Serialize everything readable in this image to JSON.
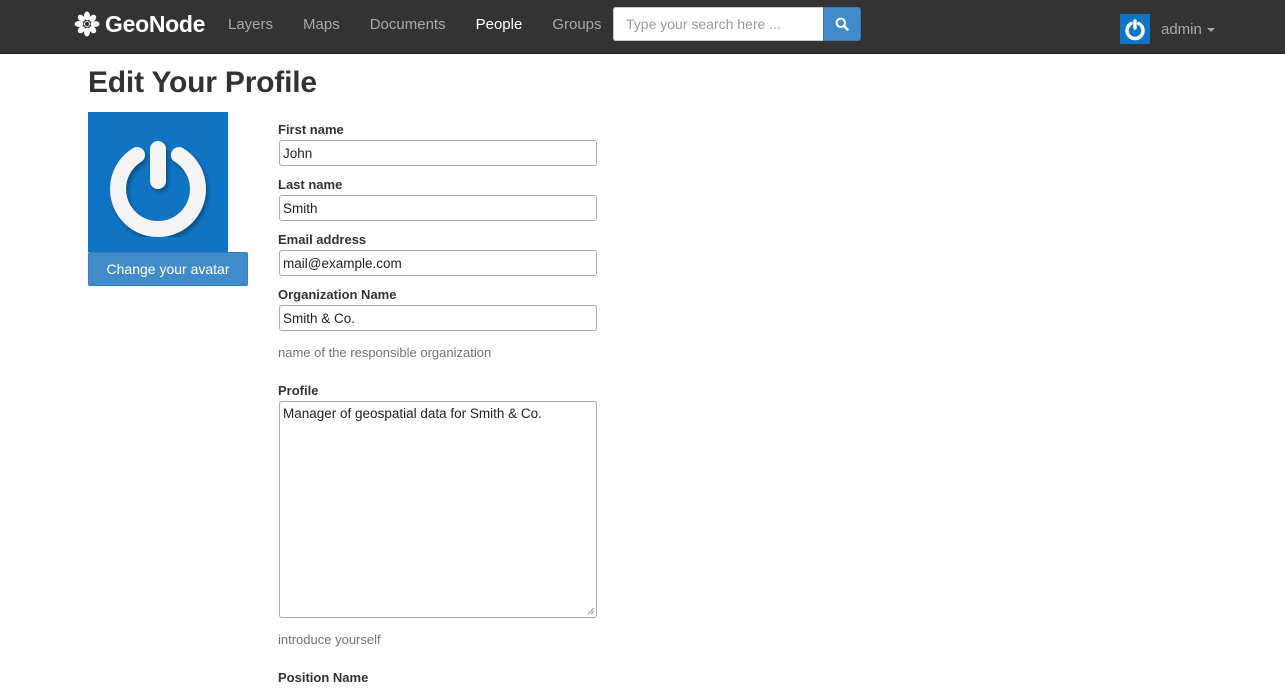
{
  "brand": {
    "name": "GeoNode"
  },
  "nav": {
    "items": [
      {
        "label": "Layers",
        "active": false
      },
      {
        "label": "Maps",
        "active": false
      },
      {
        "label": "Documents",
        "active": false
      },
      {
        "label": "People",
        "active": true
      },
      {
        "label": "Groups",
        "active": false
      }
    ]
  },
  "search": {
    "placeholder": "Type your search here ...",
    "icon": "search-icon"
  },
  "user": {
    "name": "admin",
    "avatar_icon": "gravatar-power-icon"
  },
  "page": {
    "title": "Edit Your Profile"
  },
  "avatar": {
    "change_label": "Change your avatar",
    "color": "#1074c4"
  },
  "form": {
    "first_name": {
      "label": "First name",
      "value": "John"
    },
    "last_name": {
      "label": "Last name",
      "value": "Smith"
    },
    "email": {
      "label": "Email address",
      "value": "mail@example.com"
    },
    "organization": {
      "label": "Organization Name",
      "value": "Smith & Co.",
      "help": "name of the responsible organization"
    },
    "profile": {
      "label": "Profile",
      "value": "Manager of geospatial data for Smith & Co.",
      "help": "introduce yourself"
    },
    "position": {
      "label": "Position Name"
    }
  },
  "colors": {
    "navbar": "#333333",
    "primary": "#428bca",
    "avatar_bg": "#1074c4"
  }
}
